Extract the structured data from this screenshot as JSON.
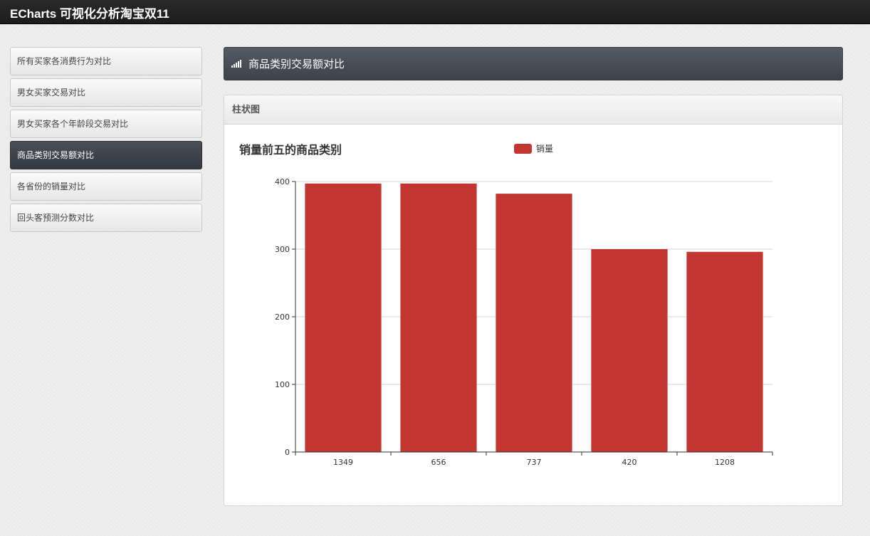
{
  "app": {
    "title": "ECharts 可视化分析淘宝双11"
  },
  "sidebar": {
    "items": [
      {
        "label": "所有买家各消费行为对比",
        "active": false
      },
      {
        "label": "男女买家交易对比",
        "active": false
      },
      {
        "label": "男女买家各个年龄段交易对比",
        "active": false
      },
      {
        "label": "商品类别交易额对比",
        "active": true
      },
      {
        "label": "各省份的销量对比",
        "active": false
      },
      {
        "label": "回头客预测分数对比",
        "active": false
      }
    ]
  },
  "main": {
    "header_icon": "signal-icon",
    "title": "商品类别交易额对比",
    "panel_title": "柱状图"
  },
  "colors": {
    "bar": "#c23531",
    "active_item": "#3e424a"
  },
  "chart_data": {
    "type": "bar",
    "title": "销量前五的商品类别",
    "categories": [
      "1349",
      "656",
      "737",
      "420",
      "1208"
    ],
    "series": [
      {
        "name": "销量",
        "values": [
          397,
          397,
          382,
          300,
          296
        ]
      }
    ],
    "ylim": [
      0,
      400
    ],
    "yticks": [
      0,
      100,
      200,
      300,
      400
    ],
    "grid": true,
    "legend_position": "top-center"
  }
}
